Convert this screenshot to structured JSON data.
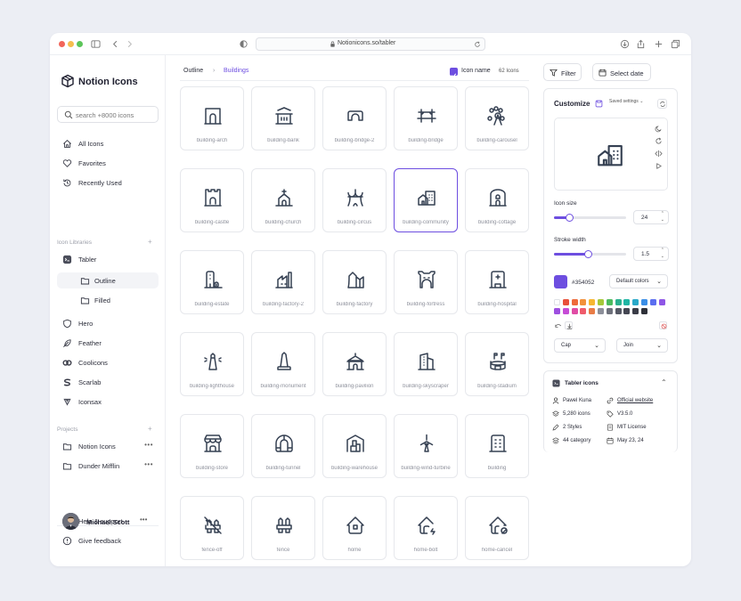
{
  "browser": {
    "url": "Notionicons.so/tabler"
  },
  "sidebar": {
    "brand": "Notion Icons",
    "search_placeholder": "search +8000 icons",
    "primary": [
      {
        "label": "All Icons",
        "icon": "home-icon"
      },
      {
        "label": "Favorites",
        "icon": "heart-icon"
      },
      {
        "label": "Recently Used",
        "icon": "history-icon"
      }
    ],
    "libraries_label": "Icon Libraries",
    "libraries": [
      {
        "label": "Tabler",
        "icon": "tabler-logo-icon"
      },
      {
        "label": "Outline",
        "icon": "folder-icon"
      },
      {
        "label": "Filled",
        "icon": "folder-icon"
      },
      {
        "label": "Hero",
        "icon": "shield-icon"
      },
      {
        "label": "Feather",
        "icon": "feather-icon"
      },
      {
        "label": "Coolicons",
        "icon": "coolicons-logo-icon"
      },
      {
        "label": "Scarlab",
        "icon": "scarlab-logo-icon"
      },
      {
        "label": "Iconsax",
        "icon": "iconsax-logo-icon"
      }
    ],
    "projects_label": "Projects",
    "projects": [
      {
        "label": "Notion Icons"
      },
      {
        "label": "Dunder Mifflin"
      }
    ],
    "footer": [
      {
        "label": "Help & support",
        "icon": "help-icon"
      },
      {
        "label": "Give feedback",
        "icon": "info-icon"
      }
    ],
    "user": {
      "name": "Michael Scott"
    }
  },
  "main": {
    "breadcrumb": [
      "Outline",
      "Buildings"
    ],
    "icon_name_toggle": "Icon name",
    "icon_count": "62 Icons",
    "icons": [
      "building-arch",
      "building-bank",
      "building-bridge-2",
      "building-bridge",
      "building-carousel",
      "building-castle",
      "building-church",
      "building-circus",
      "building-community",
      "building-cottage",
      "building-estate",
      "building-factory-2",
      "building-factory",
      "building-fortress",
      "building-hospital",
      "building-lighthouse",
      "building-monument",
      "building-pavilion",
      "building-skyscraper",
      "building-stadium",
      "building-store",
      "building-tunnel",
      "building-warehouse",
      "building-wind-turbine",
      "building",
      "fence-off",
      "fence",
      "home",
      "home-bolt",
      "home-cancel"
    ],
    "selected_icon": "building-community"
  },
  "toolbar": {
    "filter": "Filter",
    "select_date": "Select date"
  },
  "customize": {
    "title": "Customize",
    "saved_settings": "Saved settings",
    "icon_size_label": "Icon size",
    "icon_size": "24",
    "icon_size_fraction": 0.22,
    "stroke_width_label": "Stroke width",
    "stroke_width": "1.5",
    "stroke_width_fraction": 0.48,
    "color_hex": "#354052",
    "color_preset": "Default colors",
    "cap": "Cap",
    "join": "Join",
    "accent": "#6d4ee0",
    "palette": [
      "#ffffff",
      "#e8503a",
      "#ee6a3a",
      "#f2913a",
      "#f7b731",
      "#a5c83a",
      "#4cbb5f",
      "#2bb08f",
      "#1fb5a4",
      "#2aa9c9",
      "#3b8ee6",
      "#5b6ef0",
      "#8e56e6",
      "#9e4fe0",
      "#c64cd6",
      "#e04ca5",
      "#ef5b6b",
      "#e87c46",
      "#8c8f9a",
      "#6e717c",
      "#555864",
      "#444652",
      "#3a3c47",
      "#2e3039"
    ]
  },
  "tabler_card": {
    "title": "Tabler icons",
    "author": "Pawel Kuna",
    "website": "Official website",
    "count": "5,280 icons",
    "version": "V3.5.0",
    "styles": "2 Styles",
    "license": "MIT License",
    "categories": "44 category",
    "date": "May 23, 24"
  }
}
